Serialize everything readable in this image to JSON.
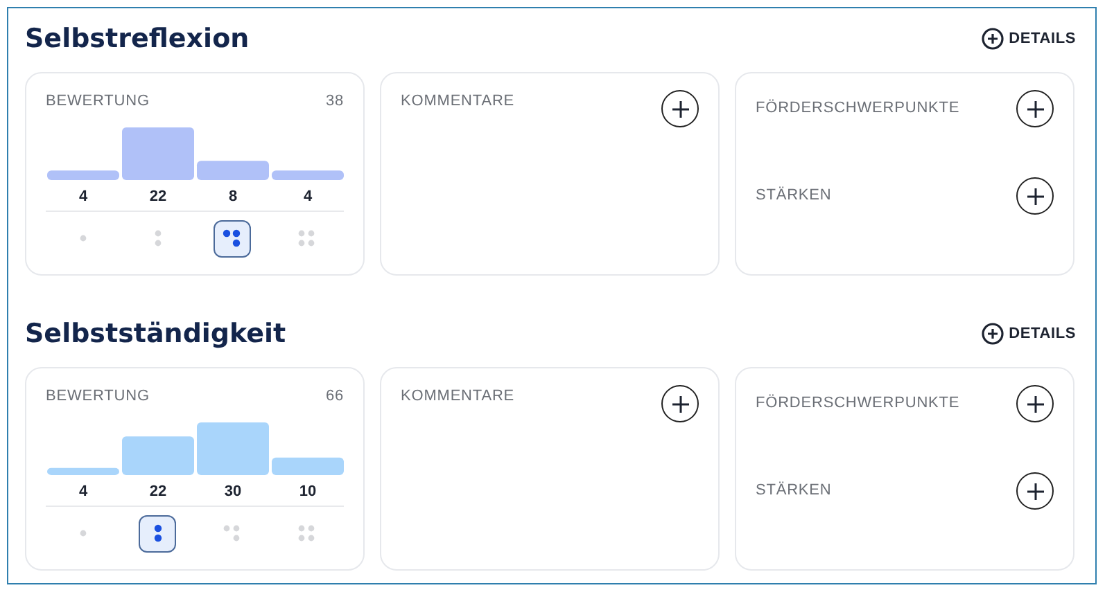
{
  "sections": [
    {
      "title": "Selbstreflexion",
      "details_button": "DETAILS",
      "rating": {
        "label": "BEWERTUNG",
        "total": "38",
        "chart_data": {
          "type": "bar",
          "series": [
            {
              "color": "#b0c1f8",
              "values": [
                4,
                22,
                8,
                4
              ]
            }
          ],
          "data_labels": true
        },
        "options": [
          {
            "selected": false
          },
          {
            "selected": false
          },
          {
            "selected": true
          },
          {
            "selected": false
          }
        ]
      },
      "comments": {
        "label": "KOMMENTARE"
      },
      "focus": {
        "label": "FÖRDERSCHWERPUNKTE"
      },
      "strengths": {
        "label": "STÄRKEN"
      }
    },
    {
      "title": "Selbstständigkeit",
      "details_button": "DETAILS",
      "rating": {
        "label": "BEWERTUNG",
        "total": "66",
        "chart_data": {
          "type": "bar",
          "series": [
            {
              "color": "#a9d5fb",
              "values": [
                4,
                22,
                30,
                10
              ]
            }
          ],
          "data_labels": true
        },
        "options": [
          {
            "selected": false
          },
          {
            "selected": true
          },
          {
            "selected": false
          },
          {
            "selected": false
          }
        ]
      },
      "comments": {
        "label": "KOMMENTARE"
      },
      "focus": {
        "label": "FÖRDERSCHWERPUNKTE"
      },
      "strengths": {
        "label": "STÄRKEN"
      }
    }
  ]
}
